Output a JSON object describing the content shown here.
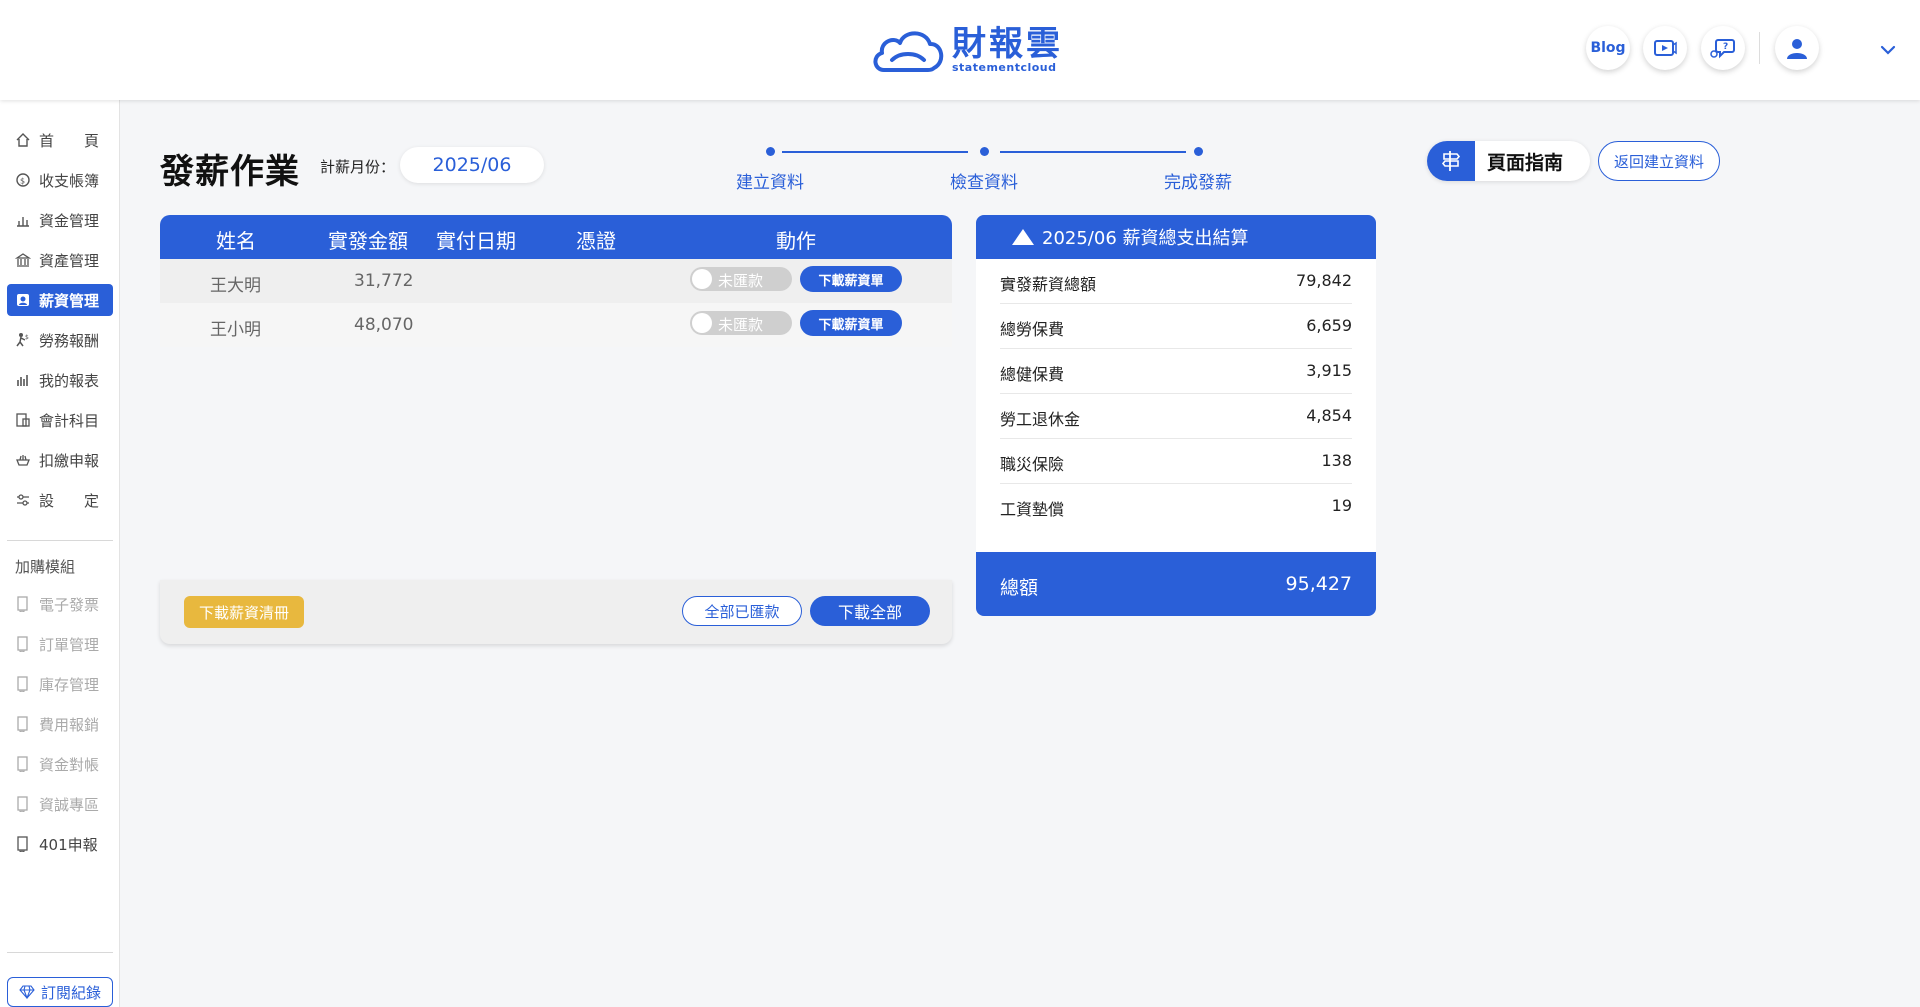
{
  "header": {
    "logo_name": "財報雲",
    "logo_sub": "statementcloud",
    "blog_label": "Blog",
    "icons": [
      "video-icon",
      "help-chat-icon",
      "user-icon",
      "chevron-down-icon"
    ]
  },
  "sidebar": {
    "items": [
      {
        "label": "首　　頁",
        "icon": "home-icon"
      },
      {
        "label": "收支帳簿",
        "icon": "coin-icon"
      },
      {
        "label": "資金管理",
        "icon": "money-icon"
      },
      {
        "label": "資產管理",
        "icon": "bank-icon"
      },
      {
        "label": "薪資管理",
        "icon": "payroll-icon",
        "active": true
      },
      {
        "label": "勞務報酬",
        "icon": "labor-icon"
      },
      {
        "label": "我的報表",
        "icon": "chart-icon"
      },
      {
        "label": "會計科目",
        "icon": "ledger-icon"
      },
      {
        "label": "扣繳申報",
        "icon": "tax-icon"
      },
      {
        "label": "設　　定",
        "icon": "settings-icon"
      }
    ],
    "addon_heading": "加購模組",
    "addons": [
      {
        "label": "電子發票",
        "disabled": true
      },
      {
        "label": "訂單管理",
        "disabled": true
      },
      {
        "label": "庫存管理",
        "disabled": true
      },
      {
        "label": "費用報銷",
        "disabled": true
      },
      {
        "label": "資金對帳",
        "disabled": true
      },
      {
        "label": "資誠專區",
        "disabled": true
      },
      {
        "label": "401申報",
        "disabled": false
      }
    ],
    "subscription_label": "訂閱紀錄"
  },
  "page": {
    "title": "發薪作業",
    "month_label": "計薪月份：",
    "month_value": "2025/06"
  },
  "stepper": {
    "steps": [
      "建立資料",
      "檢查資料",
      "完成發薪"
    ]
  },
  "guide": {
    "label": "頁面指南",
    "back_label": "返回建立資料"
  },
  "table": {
    "headers": [
      "姓名",
      "實發金額",
      "實付日期",
      "憑證",
      "動作"
    ],
    "rows": [
      {
        "name": "王大明",
        "amount": "31,772",
        "date": "",
        "voucher": "",
        "toggle_label": "未匯款",
        "download_label": "下載薪資單"
      },
      {
        "name": "王小明",
        "amount": "48,070",
        "date": "",
        "voucher": "",
        "toggle_label": "未匯款",
        "download_label": "下載薪資單"
      }
    ],
    "footer": {
      "list_button": "下載薪資清冊",
      "all_paid_button": "全部已匯款",
      "download_all_button": "下載全部"
    }
  },
  "summary": {
    "title": "2025/06 薪資總支出結算",
    "rows": [
      {
        "label": "實發薪資總額",
        "value": "79,842"
      },
      {
        "label": "總勞保費",
        "value": "6,659"
      },
      {
        "label": "總健保費",
        "value": "3,915"
      },
      {
        "label": "勞工退休金",
        "value": "4,854"
      },
      {
        "label": "職災保險",
        "value": "138"
      },
      {
        "label": "工資墊償",
        "value": "19"
      }
    ],
    "total_label": "總額",
    "total_value": "95,427"
  },
  "colors": {
    "accent": "#2a5fd8",
    "warning": "#e8b83e"
  }
}
